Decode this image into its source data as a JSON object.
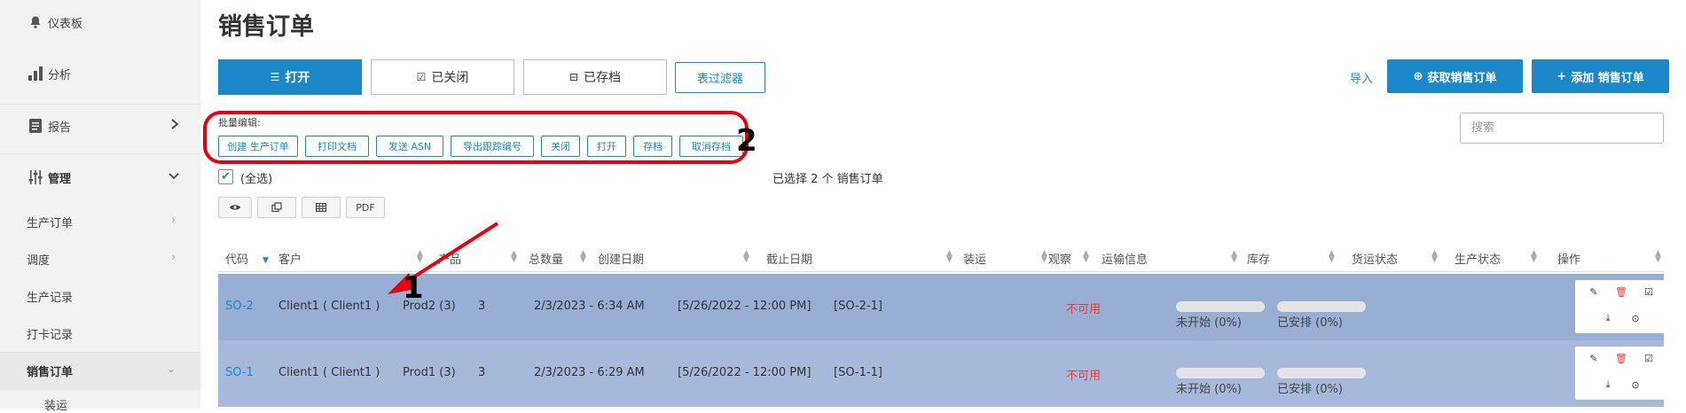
{
  "sidebar": {
    "dashboard": "仪表板",
    "analysis": "分析",
    "reports": "报告",
    "management": "管理",
    "sub_items": [
      "生产订单",
      "调度",
      "生产记录",
      "打卡记录",
      "销售订单",
      "装运"
    ]
  },
  "page": {
    "title": "销售订单"
  },
  "tabs": [
    "打开",
    "已关闭",
    "已存档"
  ],
  "filter_button": "表过滤器",
  "toolbar": {
    "import": "导入",
    "fetch_orders": "获取销售订单",
    "add_order": "添加 销售订单"
  },
  "search": {
    "placeholder": "搜索"
  },
  "bulk": {
    "label": "批量编辑:",
    "buttons": [
      "创建 生产订单",
      "打印文档",
      "发送 ASN",
      "导出跟踪编号",
      "关闭",
      "打开",
      "存档",
      "取消存档"
    ]
  },
  "select_all": "(全选)",
  "selected_count": "已选择 2 个 销售订单",
  "view_buttons": {
    "pdf": "PDF"
  },
  "table": {
    "headers": [
      "代码",
      "客户",
      "产品",
      "总数量",
      "创建日期",
      "截止日期",
      "装运",
      "观察",
      "运输信息",
      "库存",
      "货运状态",
      "生产状态",
      "操作"
    ],
    "rows": [
      {
        "code": "SO-2",
        "customer": "Client1 ( Client1 )",
        "product": "Prod2 (3)",
        "qty": "3",
        "created": "2/3/2023 - 6:34 AM",
        "deadline": "[5/26/2022 - 12:00 PM]",
        "shipping": "[SO-2-1]",
        "stock": "不可用",
        "ship_status": "未开始 (0%)",
        "prod_status": "已安排 (0%)"
      },
      {
        "code": "SO-1",
        "customer": "Client1 ( Client1 )",
        "product": "Prod1 (3)",
        "qty": "3",
        "created": "2/3/2023 - 6:29 AM",
        "deadline": "[5/26/2022 - 12:00 PM]",
        "shipping": "[SO-1-1]",
        "stock": "不可用",
        "ship_status": "未开始 (0%)",
        "prod_status": "已安排 (0%)"
      }
    ]
  },
  "annotations": {
    "arrow_label": "1",
    "box_label": "2"
  },
  "colors": {
    "accent": "#1a88c9",
    "row_selected_1": "#98aed3",
    "row_selected_2": "#a6b9db",
    "highlight_red": "#e60012",
    "unavailable": "#e04040"
  }
}
